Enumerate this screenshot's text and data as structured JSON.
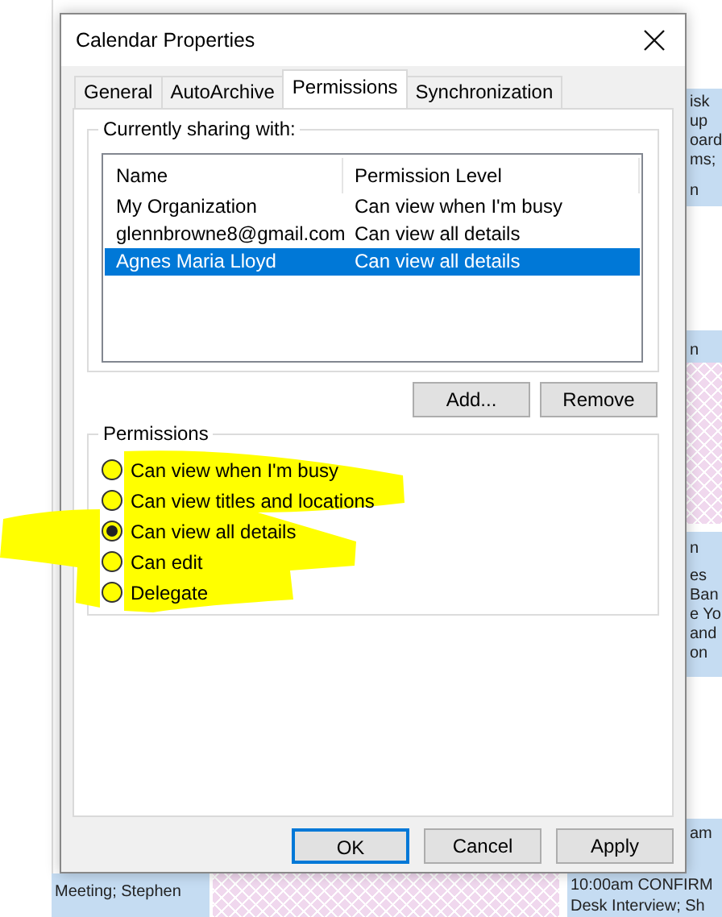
{
  "dialog": {
    "title": "Calendar Properties",
    "tabs": [
      {
        "label": "General",
        "selected": false
      },
      {
        "label": "AutoArchive",
        "selected": false
      },
      {
        "label": "Permissions",
        "selected": true
      },
      {
        "label": "Synchronization",
        "selected": false
      }
    ],
    "sharing": {
      "legend": "Currently sharing with:",
      "columns": [
        "Name",
        "Permission Level"
      ],
      "rows": [
        {
          "name": "My Organization",
          "permission": "Can view when I'm busy",
          "selected": false
        },
        {
          "name": "glennbrowne8@gmail.com",
          "permission": "Can view all details",
          "selected": false
        },
        {
          "name": "Agnes Maria Lloyd",
          "permission": "Can view all details",
          "selected": true
        }
      ],
      "buttons": [
        "Add...",
        "Remove"
      ]
    },
    "permissions": {
      "legend": "Permissions",
      "options": [
        {
          "label": "Can view when I'm busy",
          "selected": false
        },
        {
          "label": "Can view titles and locations",
          "selected": false
        },
        {
          "label": "Can view all details",
          "selected": true
        },
        {
          "label": "Can edit",
          "selected": false
        },
        {
          "label": "Delegate",
          "selected": false
        }
      ]
    },
    "footer_buttons": [
      {
        "label": "OK",
        "default": true
      },
      {
        "label": "Cancel",
        "default": false
      },
      {
        "label": "Apply",
        "default": false
      }
    ]
  },
  "calendar": {
    "right_fragments": [
      "isk",
      "up",
      "oard",
      "ms;",
      "n",
      "n",
      "n",
      "es",
      "Ban",
      "e Yo",
      "and",
      "on",
      "am"
    ],
    "bottom_texts": [
      "Meeting; Stephen",
      "10:00am CONFIRM",
      "Desk Interview; Sh"
    ]
  }
}
